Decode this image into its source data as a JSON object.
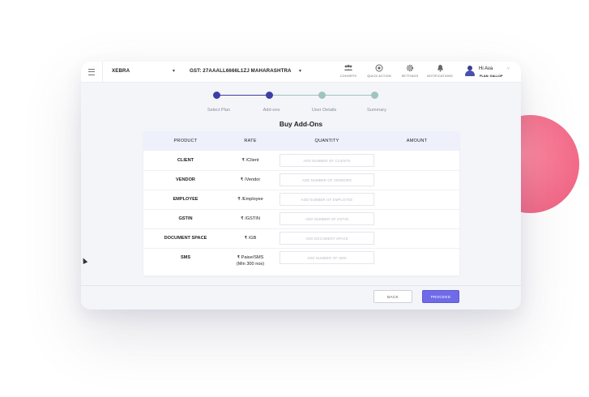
{
  "header": {
    "company": "XEBRA",
    "gst": "GST: 27AAALL6666L1ZJ MAHARASHTRA",
    "tools": [
      {
        "label": "COHORTS",
        "icon": "users-icon"
      },
      {
        "label": "QUICK ACTION",
        "icon": "plus-circle-icon"
      },
      {
        "label": "SETTINGS",
        "icon": "gear-icon"
      },
      {
        "label": "NOTIFICATIONS",
        "icon": "bell-icon"
      }
    ],
    "user_greeting": "Hi Ava",
    "plan": "PLAN: GALLOP"
  },
  "steps": [
    {
      "label": "Select Plan",
      "color": "#3d3fa5"
    },
    {
      "label": "Add-ons",
      "color": "#3d3fa5"
    },
    {
      "label": "User Details",
      "color": "#9fc4c0"
    },
    {
      "label": "Summary",
      "color": "#9fc4c0"
    }
  ],
  "page_title": "Buy Add-Ons",
  "table": {
    "headers": [
      "PRODUCT",
      "RATE",
      "QUANTITY",
      "AMOUNT"
    ],
    "rows": [
      {
        "product": "CLIENT",
        "rate": "₹ /Client",
        "rate2": "",
        "placeholder": "ADD NUMBER OF CLIENTS"
      },
      {
        "product": "VENDOR",
        "rate": "₹ /Vendor",
        "rate2": "",
        "placeholder": "ADD NUMBER OF VENDORS"
      },
      {
        "product": "EMPLOYEE",
        "rate": "₹ /Employee",
        "rate2": "",
        "placeholder": "ADD NUMBER OF EMPLOYEE"
      },
      {
        "product": "GSTIN",
        "rate": "₹ /GSTIN",
        "rate2": "",
        "placeholder": "ADD NUMBER OF GSTIN"
      },
      {
        "product": "DOCUMENT SPACE",
        "rate": "₹ /GB",
        "rate2": "",
        "placeholder": "ADD DOCUMENT SPACE"
      },
      {
        "product": "SMS",
        "rate": "₹ Paise/SMS",
        "rate2": "(Min 300 nos)",
        "placeholder": "ADD NUMBER OF SMS"
      }
    ]
  },
  "buttons": {
    "back": "BACK",
    "proceed": "PROCEED"
  },
  "colors": {
    "accent": "#6f6be8",
    "step_done": "#3d3fa5",
    "step_todo": "#9fc4c0",
    "blob": "#f46f8c"
  }
}
